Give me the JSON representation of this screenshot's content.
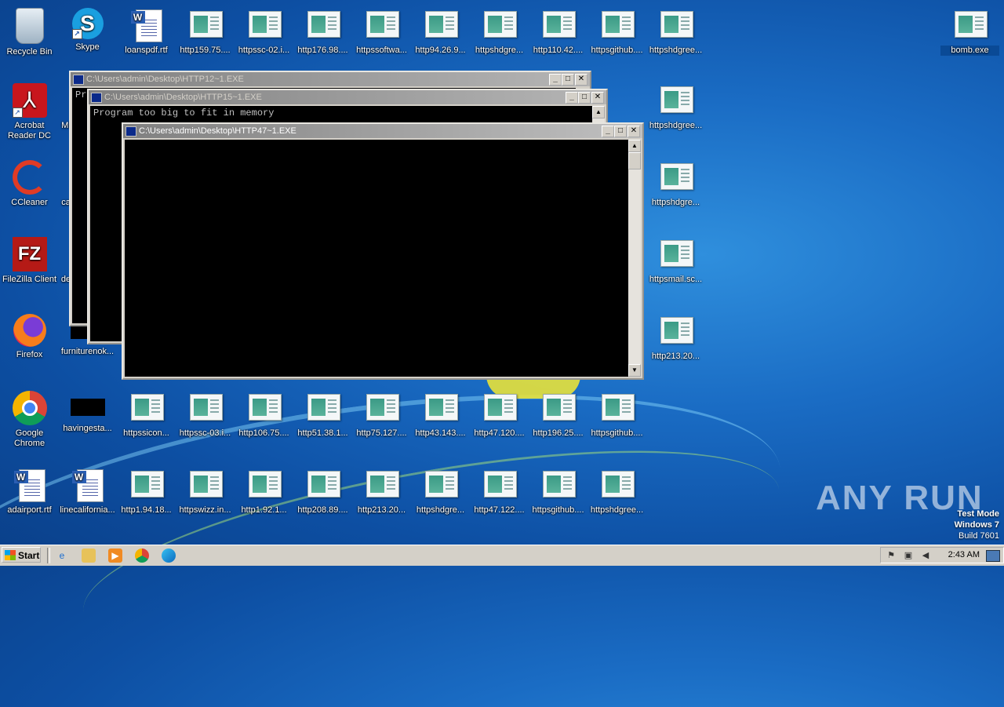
{
  "desktop": {
    "icons_top_row": [
      {
        "label": "Recycle Bin",
        "icon": "recycle-bin-icon"
      },
      {
        "label": "Skype",
        "icon": "skype-icon"
      },
      {
        "label": "loanspdf.rtf",
        "icon": "word-doc-icon"
      },
      {
        "label": "http159.75....",
        "icon": "html-file-icon"
      },
      {
        "label": "httpssc-02.i...",
        "icon": "html-file-icon"
      },
      {
        "label": "http176.98....",
        "icon": "html-file-icon"
      },
      {
        "label": "httpssoftwa...",
        "icon": "html-file-icon"
      },
      {
        "label": "http94.26.9...",
        "icon": "html-file-icon"
      },
      {
        "label": "httpshdgre...",
        "icon": "html-file-icon"
      },
      {
        "label": "http110.42....",
        "icon": "html-file-icon"
      },
      {
        "label": "httpsgithub....",
        "icon": "html-file-icon"
      },
      {
        "label": "httpshdgree...",
        "icon": "html-file-icon"
      }
    ],
    "icons_left_col": [
      {
        "label": "Acrobat Reader DC",
        "icon": "acrobat-icon"
      },
      {
        "label": "CCleaner",
        "icon": "ccleaner-icon"
      },
      {
        "label": "FileZilla Client",
        "icon": "filezilla-icon"
      },
      {
        "label": "Firefox",
        "icon": "firefox-icon"
      },
      {
        "label": "Google Chrome",
        "icon": "chrome-icon"
      },
      {
        "label": "adairport.rtf",
        "icon": "word-doc-icon"
      }
    ],
    "icons_col2_partial": [
      {
        "label": "Mi"
      },
      {
        "label": "ca"
      },
      {
        "label": "de"
      },
      {
        "label": "furniturenok..."
      },
      {
        "label": "havingesta..."
      },
      {
        "label": "linecalifornia..."
      }
    ],
    "icons_right_col": [
      {
        "label": "httpshdgree..."
      },
      {
        "label": "httpshdgre..."
      },
      {
        "label": "httpsmail.sc..."
      },
      {
        "label": "http213.20..."
      }
    ],
    "row_mid": [
      "httpssicon...",
      "httpssc-03.i...",
      "http106.75....",
      "http51.38.1...",
      "http75.127....",
      "http43.143....",
      "http47.120....",
      "http196.25....",
      "httpsgithub...."
    ],
    "row_bottom": [
      "http1.94.18...",
      "httpswizz.in...",
      "http1.92.1...",
      "http208.89....",
      "http213.20...",
      "httpshdgre...",
      "http47.122....",
      "httpsgithub....",
      "httpshdgree..."
    ],
    "selected_icon": {
      "label": "bomb.exe"
    }
  },
  "windows": [
    {
      "title": "C:\\Users\\admin\\Desktop\\HTTP12~1.EXE",
      "text": "Pr"
    },
    {
      "title": "C:\\Users\\admin\\Desktop\\HTTP15~1.EXE",
      "text": "Program too big to fit in memory"
    },
    {
      "title": "C:\\Users\\admin\\Desktop\\HTTP47~1.EXE",
      "text": ""
    }
  ],
  "controls": {
    "minimize": "_",
    "maximize": "□",
    "close": "✕"
  },
  "watermark": {
    "brand": "ANY RUN",
    "line1": "Test Mode",
    "line2": "Windows 7",
    "line3": "Build 7601"
  },
  "taskbar": {
    "start_label": "Start",
    "clock": "2:43 AM"
  }
}
